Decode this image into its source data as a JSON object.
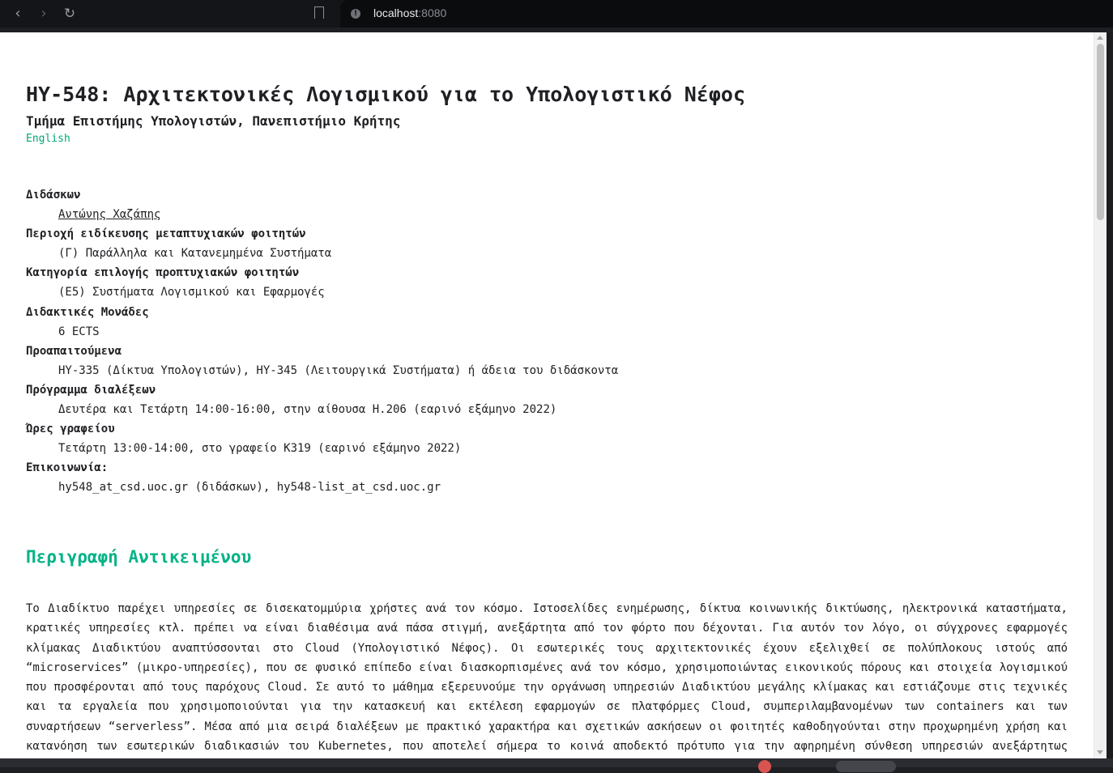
{
  "browser": {
    "url_host": "localhost",
    "url_port": ":8080"
  },
  "page": {
    "title": "HY-548: Αρχιτεκτονικές Λογισμικού για το Υπολογιστικό Νέφος",
    "subtitle": "Τμήμα Επιστήμης Υπολογιστών, Πανεπιστήμιο Κρήτης",
    "language_link": "English",
    "info": [
      {
        "label": "Διδάσκων",
        "value": "Αντώνης Χαζάπης"
      },
      {
        "label": "Περιοχή ειδίκευσης μεταπτυχιακών φοιτητών",
        "value": "(Γ) Παράλληλα και Κατανεμημένα Συστήματα"
      },
      {
        "label": "Κατηγορία επιλογής προπτυχιακών φοιτητών",
        "value": "(Ε5) Συστήματα Λογισμικού και Εφαρμογές"
      },
      {
        "label": "Διδακτικές Μονάδες",
        "value": "6 ECTS"
      },
      {
        "label": "Προαπαιτούμενα",
        "value": "HY-335 (Δίκτυα Υπολογιστών), HY-345 (Λειτουργικά Συστήματα) ή άδεια του διδάσκοντα"
      },
      {
        "label": "Πρόγραμμα διαλέξεων",
        "value": "Δευτέρα και Τετάρτη 14:00-16:00, στην αίθουσα Η.206 (εαρινό εξάμηνο 2022)"
      },
      {
        "label": "Ώρες γραφείου",
        "value": "Τετάρτη 13:00-14:00, στο γραφείο Κ319 (εαρινό εξάμηνο 2022)"
      },
      {
        "label": "Επικοινωνία:",
        "value": "hy548_at_csd.uoc.gr (διδάσκων), hy548-list_at_csd.uoc.gr"
      }
    ],
    "section_title": "Περιγραφή Αντικειμένου",
    "description": "Το Διαδίκτυο παρέχει υπηρεσίες σε δισεκατομμύρια χρήστες ανά τον κόσμο. Ιστοσελίδες ενημέρωσης, δίκτυα κοινωνικής δικτύωσης, ηλεκτρονικά καταστήματα, κρατικές υπηρεσίες κτλ. πρέπει να είναι διαθέσιμα ανά πάσα στιγμή, ανεξάρτητα από τον φόρτο που δέχονται. Για αυτόν τον λόγο, οι σύγχρονες εφαρμογές κλίμακας Διαδικτύου αναπτύσσονται στο Cloud (Υπολογιστικό Νέφος). Οι εσωτερικές τους αρχιτεκτονικές έχουν εξελιχθεί σε πολύπλοκους ιστούς από “microservices” (μικρο-υπηρεσίες), που σε φυσικό επίπεδο είναι διασκορπισμένες ανά τον κόσμο, χρησιμοποιώντας εικονικούς πόρους και στοιχεία λογισμικού που προσφέρονται από τους παρόχους Cloud. Σε αυτό το μάθημα εξερευνούμε την οργάνωση υπηρεσιών Διαδικτύου μεγάλης κλίμακας και εστιάζουμε στις τεχνικές και τα εργαλεία που χρησιμοποιούνται για την κατασκευή και εκτέλεση εφαρμογών σε πλατφόρμες Cloud, συμπεριλαμβανομένων των containers και των συναρτήσεων “serverless”. Μέσα από μια σειρά διαλέξεων με πρακτικό χαρακτήρα και σχετικών ασκήσεων οι φοιτητές καθοδηγούνται στην προχωρημένη χρήση και κατανόηση των εσωτερικών διαδικασιών του Kubernetes, που αποτελεί σήμερα το κοινά αποδεκτό πρότυπο για την αφηρημένη σύνθεση υπηρεσιών ανεξάρτητως παρόχου."
  }
}
